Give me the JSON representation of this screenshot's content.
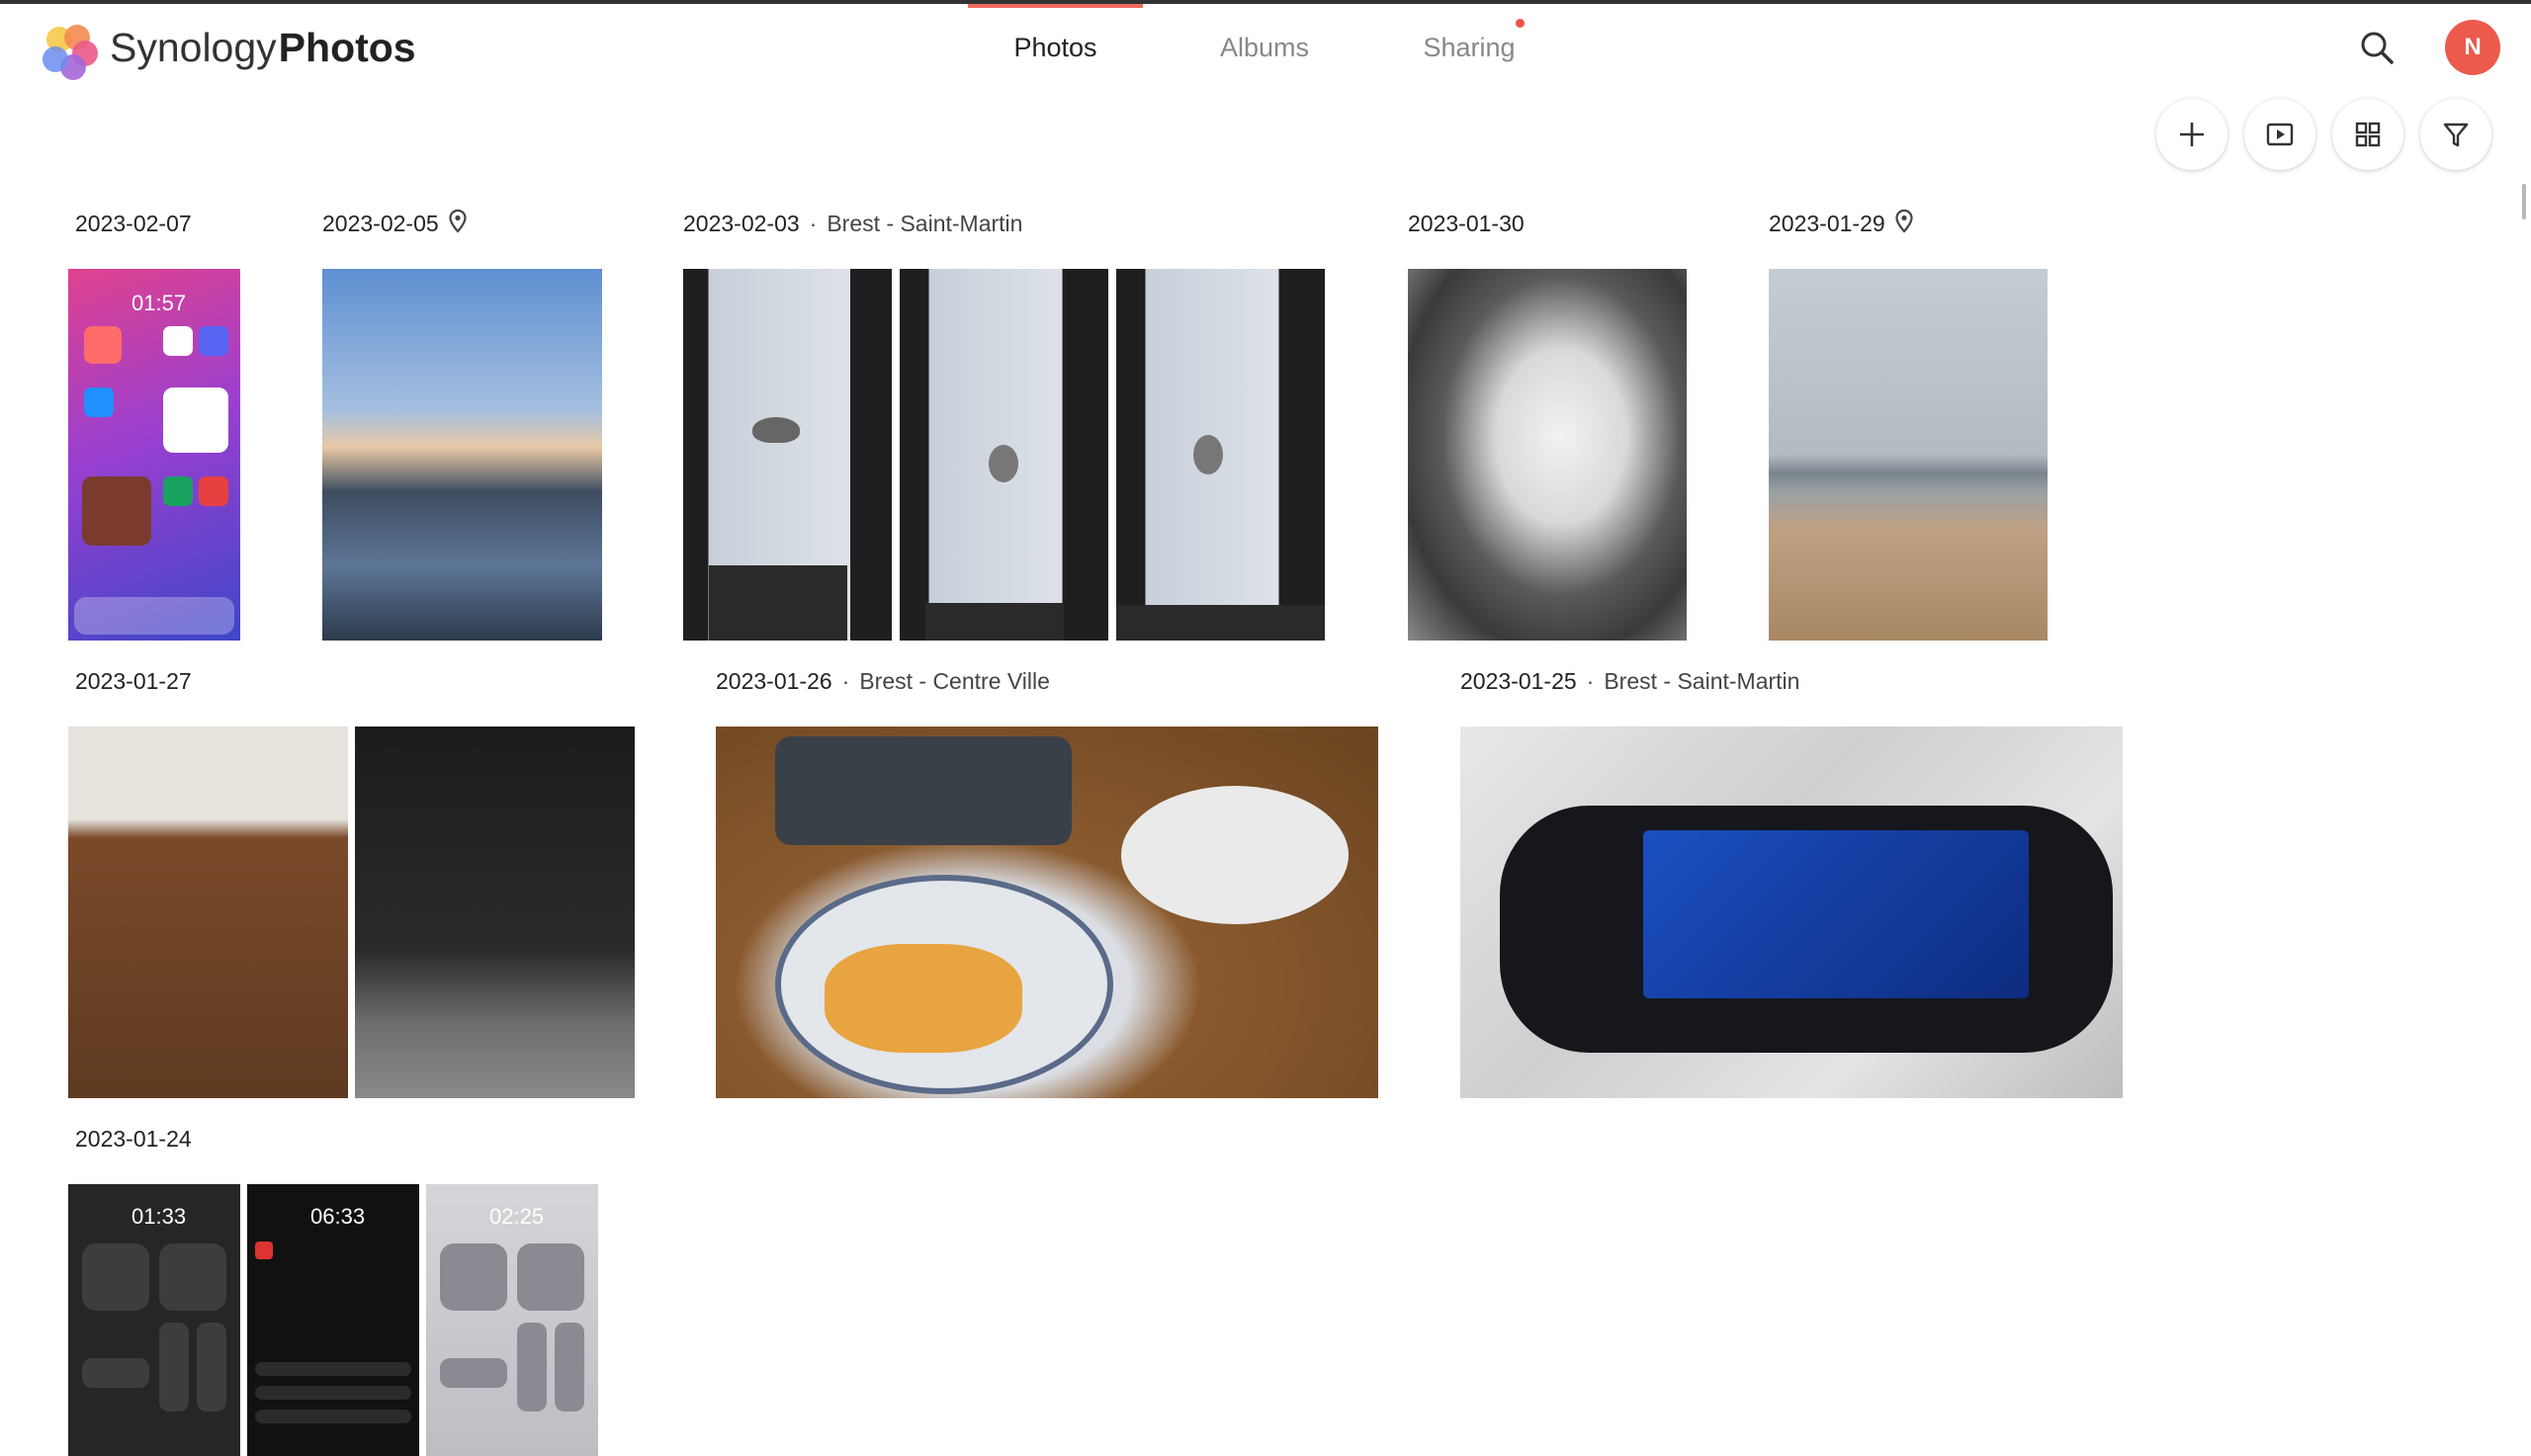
{
  "app": {
    "brand_light": "Synology",
    "brand_bold": "Photos",
    "accent_color": "#f06b5e"
  },
  "tabs": [
    {
      "label": "Photos",
      "active": true
    },
    {
      "label": "Albums",
      "active": false
    },
    {
      "label": "Sharing",
      "active": false,
      "has_notification": true
    }
  ],
  "user": {
    "initial": "N",
    "avatar_color": "#ec5a4b"
  },
  "icons": {
    "search": "search-icon",
    "toolbar": [
      "plus-icon",
      "slideshow-icon",
      "grid-view-icon",
      "filter-icon"
    ]
  },
  "groups": [
    {
      "date": "2023-02-07",
      "location": "",
      "has_pin": false
    },
    {
      "date": "2023-02-05",
      "location": "",
      "has_pin": true
    },
    {
      "date": "2023-02-03",
      "location": "Brest - Saint-Martin",
      "has_pin": false
    },
    {
      "date": "2023-01-30",
      "location": "",
      "has_pin": false
    },
    {
      "date": "2023-01-29",
      "location": "",
      "has_pin": true
    },
    {
      "date": "2023-01-27",
      "location": "",
      "has_pin": false
    },
    {
      "date": "2023-01-26",
      "location": "Brest - Centre Ville",
      "has_pin": false
    },
    {
      "date": "2023-01-25",
      "location": "Brest - Saint-Martin",
      "has_pin": false
    },
    {
      "date": "2023-01-24",
      "location": "",
      "has_pin": false
    }
  ],
  "location_separator": "·",
  "thumbnails": {
    "phone_home_clock": "01:57",
    "control_center_1_clock": "01:33",
    "discord_clock": "06:33",
    "control_center_2_clock": "02:25"
  }
}
